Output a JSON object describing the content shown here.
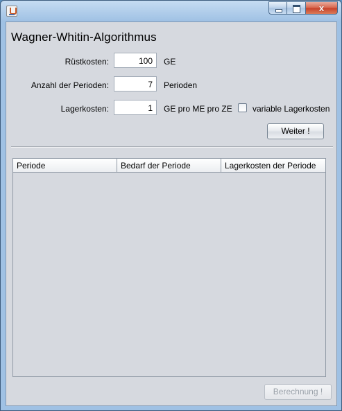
{
  "window": {
    "title": "",
    "controls": {
      "minimize": "",
      "maximize": "",
      "close": "x"
    }
  },
  "heading": "Wagner-Whitin-Algorithmus",
  "form": {
    "ruestkosten": {
      "label": "Rüstkosten:",
      "value": "100",
      "unit": "GE"
    },
    "perioden": {
      "label": "Anzahl der Perioden:",
      "value": "7",
      "unit": "Perioden"
    },
    "lagerkosten": {
      "label": "Lagerkosten:",
      "value": "1",
      "unit": "GE pro ME pro ZE"
    },
    "variable_lagerkosten": {
      "label": "variable Lagerkosten",
      "checked": false
    }
  },
  "buttons": {
    "weiter": "Weiter !",
    "berechnung": "Berechnung !"
  },
  "table": {
    "columns": [
      "Periode",
      "Bedarf der Periode",
      "Lagerkosten der Periode"
    ],
    "rows": []
  }
}
